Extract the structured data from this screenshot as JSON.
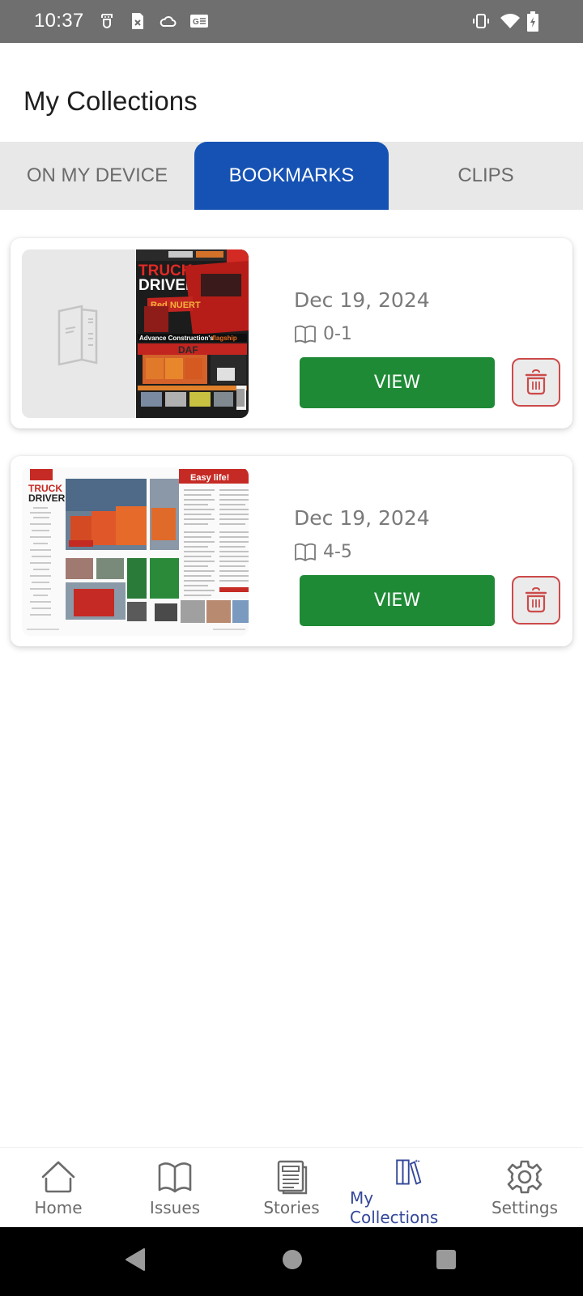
{
  "status_bar": {
    "time": "10:37",
    "left_icons": [
      "notification-app-icon",
      "sim-x-icon",
      "cloud-icon",
      "news-app-icon"
    ],
    "right_icons": [
      "vibrate-icon",
      "wifi-icon",
      "battery-charging-icon"
    ]
  },
  "header": {
    "title": "My Collections"
  },
  "tabs": [
    {
      "label": "ON MY DEVICE",
      "active": false
    },
    {
      "label": "BOOKMARKS",
      "active": true
    },
    {
      "label": "CLIPS",
      "active": false
    }
  ],
  "bookmarks": [
    {
      "date": "Dec 19, 2024",
      "pages": "0-1",
      "thumbnail": "Truck & Driver cover with blank left page",
      "view_label": "VIEW",
      "delete_icon": "trash-icon"
    },
    {
      "date": "Dec 19, 2024",
      "pages": "4-5",
      "thumbnail": "Truck & Driver contents spread",
      "view_label": "VIEW",
      "delete_icon": "trash-icon"
    }
  ],
  "bottom_nav": [
    {
      "label": "Home",
      "icon": "home-icon",
      "active": false
    },
    {
      "label": "Issues",
      "icon": "book-icon",
      "active": false
    },
    {
      "label": "Stories",
      "icon": "newspaper-icon",
      "active": false
    },
    {
      "label": "My Collections",
      "icon": "collections-icon",
      "active": true
    },
    {
      "label": "Settings",
      "icon": "gear-icon",
      "active": false
    }
  ],
  "colors": {
    "accent_blue": "#1552b4",
    "view_green": "#1f8a36",
    "delete_red": "#cc4a4a",
    "nav_active": "#34489a"
  }
}
